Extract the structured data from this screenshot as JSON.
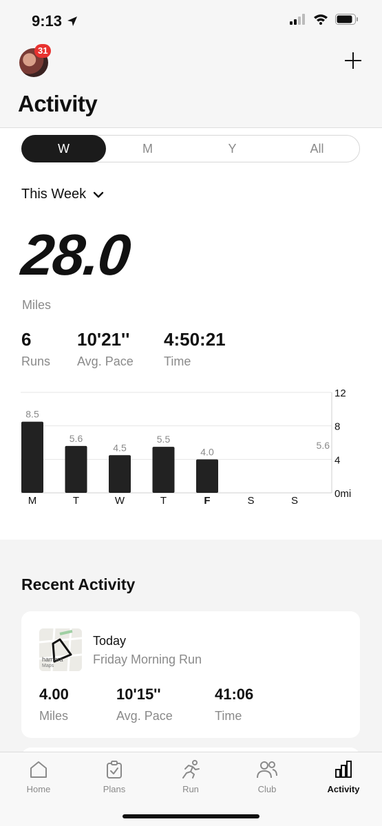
{
  "status": {
    "time": "9:13"
  },
  "header": {
    "badge_count": "31",
    "title": "Activity"
  },
  "segments": [
    {
      "label": "W",
      "active": true
    },
    {
      "label": "M",
      "active": false
    },
    {
      "label": "Y",
      "active": false
    },
    {
      "label": "All",
      "active": false
    }
  ],
  "period": {
    "label": "This Week"
  },
  "summary": {
    "distance": "28.0",
    "unit": "Miles",
    "stats": [
      {
        "value": "6",
        "label": "Runs"
      },
      {
        "value": "10'21''",
        "label": "Avg. Pace"
      },
      {
        "value": "4:50:21",
        "label": "Time"
      }
    ]
  },
  "chart_data": {
    "type": "bar",
    "categories": [
      "M",
      "T",
      "W",
      "T",
      "F",
      "S",
      "S"
    ],
    "values": [
      8.5,
      5.6,
      4.5,
      5.5,
      4.0,
      0,
      0
    ],
    "value_labels": [
      "8.5",
      "5.6",
      "4.5",
      "5.5",
      "4.0",
      "",
      ""
    ],
    "y_ticks": [
      "0mi",
      "4",
      "8",
      "12"
    ],
    "y_tick_values": [
      0,
      4,
      8,
      12
    ],
    "ylim": [
      0,
      12
    ],
    "average": 5.6,
    "average_label": "5.6",
    "bold_category_index": 4
  },
  "recent": {
    "title": "Recent Activity",
    "card": {
      "map_label": "hambra",
      "map_brand": "Maps",
      "date": "Today",
      "name": "Friday Morning Run",
      "stats": [
        {
          "value": "4.00",
          "label": "Miles"
        },
        {
          "value": "10'15''",
          "label": "Avg. Pace"
        },
        {
          "value": "41:06",
          "label": "Time"
        }
      ]
    }
  },
  "tabs": [
    {
      "label": "Home",
      "icon": "home-icon",
      "active": false
    },
    {
      "label": "Plans",
      "icon": "plans-icon",
      "active": false
    },
    {
      "label": "Run",
      "icon": "run-icon",
      "active": false
    },
    {
      "label": "Club",
      "icon": "club-icon",
      "active": false
    },
    {
      "label": "Activity",
      "icon": "activity-icon",
      "active": true
    }
  ]
}
